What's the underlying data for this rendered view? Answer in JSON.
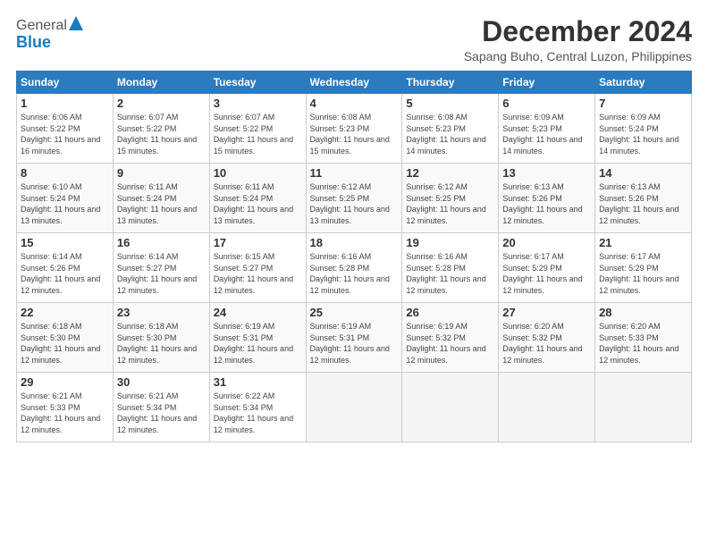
{
  "header": {
    "logo_general": "General",
    "logo_blue": "Blue",
    "title": "December 2024",
    "subtitle": "Sapang Buho, Central Luzon, Philippines"
  },
  "calendar": {
    "days_of_week": [
      "Sunday",
      "Monday",
      "Tuesday",
      "Wednesday",
      "Thursday",
      "Friday",
      "Saturday"
    ],
    "weeks": [
      [
        {
          "day": "1",
          "sunrise": "6:06 AM",
          "sunset": "5:22 PM",
          "daylight": "11 hours and 16 minutes."
        },
        {
          "day": "2",
          "sunrise": "6:07 AM",
          "sunset": "5:22 PM",
          "daylight": "11 hours and 15 minutes."
        },
        {
          "day": "3",
          "sunrise": "6:07 AM",
          "sunset": "5:22 PM",
          "daylight": "11 hours and 15 minutes."
        },
        {
          "day": "4",
          "sunrise": "6:08 AM",
          "sunset": "5:23 PM",
          "daylight": "11 hours and 15 minutes."
        },
        {
          "day": "5",
          "sunrise": "6:08 AM",
          "sunset": "5:23 PM",
          "daylight": "11 hours and 14 minutes."
        },
        {
          "day": "6",
          "sunrise": "6:09 AM",
          "sunset": "5:23 PM",
          "daylight": "11 hours and 14 minutes."
        },
        {
          "day": "7",
          "sunrise": "6:09 AM",
          "sunset": "5:24 PM",
          "daylight": "11 hours and 14 minutes."
        }
      ],
      [
        {
          "day": "8",
          "sunrise": "6:10 AM",
          "sunset": "5:24 PM",
          "daylight": "11 hours and 13 minutes."
        },
        {
          "day": "9",
          "sunrise": "6:11 AM",
          "sunset": "5:24 PM",
          "daylight": "11 hours and 13 minutes."
        },
        {
          "day": "10",
          "sunrise": "6:11 AM",
          "sunset": "5:24 PM",
          "daylight": "11 hours and 13 minutes."
        },
        {
          "day": "11",
          "sunrise": "6:12 AM",
          "sunset": "5:25 PM",
          "daylight": "11 hours and 13 minutes."
        },
        {
          "day": "12",
          "sunrise": "6:12 AM",
          "sunset": "5:25 PM",
          "daylight": "11 hours and 12 minutes."
        },
        {
          "day": "13",
          "sunrise": "6:13 AM",
          "sunset": "5:26 PM",
          "daylight": "11 hours and 12 minutes."
        },
        {
          "day": "14",
          "sunrise": "6:13 AM",
          "sunset": "5:26 PM",
          "daylight": "11 hours and 12 minutes."
        }
      ],
      [
        {
          "day": "15",
          "sunrise": "6:14 AM",
          "sunset": "5:26 PM",
          "daylight": "11 hours and 12 minutes."
        },
        {
          "day": "16",
          "sunrise": "6:14 AM",
          "sunset": "5:27 PM",
          "daylight": "11 hours and 12 minutes."
        },
        {
          "day": "17",
          "sunrise": "6:15 AM",
          "sunset": "5:27 PM",
          "daylight": "11 hours and 12 minutes."
        },
        {
          "day": "18",
          "sunrise": "6:16 AM",
          "sunset": "5:28 PM",
          "daylight": "11 hours and 12 minutes."
        },
        {
          "day": "19",
          "sunrise": "6:16 AM",
          "sunset": "5:28 PM",
          "daylight": "11 hours and 12 minutes."
        },
        {
          "day": "20",
          "sunrise": "6:17 AM",
          "sunset": "5:29 PM",
          "daylight": "11 hours and 12 minutes."
        },
        {
          "day": "21",
          "sunrise": "6:17 AM",
          "sunset": "5:29 PM",
          "daylight": "11 hours and 12 minutes."
        }
      ],
      [
        {
          "day": "22",
          "sunrise": "6:18 AM",
          "sunset": "5:30 PM",
          "daylight": "11 hours and 12 minutes."
        },
        {
          "day": "23",
          "sunrise": "6:18 AM",
          "sunset": "5:30 PM",
          "daylight": "11 hours and 12 minutes."
        },
        {
          "day": "24",
          "sunrise": "6:19 AM",
          "sunset": "5:31 PM",
          "daylight": "11 hours and 12 minutes."
        },
        {
          "day": "25",
          "sunrise": "6:19 AM",
          "sunset": "5:31 PM",
          "daylight": "11 hours and 12 minutes."
        },
        {
          "day": "26",
          "sunrise": "6:19 AM",
          "sunset": "5:32 PM",
          "daylight": "11 hours and 12 minutes."
        },
        {
          "day": "27",
          "sunrise": "6:20 AM",
          "sunset": "5:32 PM",
          "daylight": "11 hours and 12 minutes."
        },
        {
          "day": "28",
          "sunrise": "6:20 AM",
          "sunset": "5:33 PM",
          "daylight": "11 hours and 12 minutes."
        }
      ],
      [
        {
          "day": "29",
          "sunrise": "6:21 AM",
          "sunset": "5:33 PM",
          "daylight": "11 hours and 12 minutes."
        },
        {
          "day": "30",
          "sunrise": "6:21 AM",
          "sunset": "5:34 PM",
          "daylight": "11 hours and 12 minutes."
        },
        {
          "day": "31",
          "sunrise": "6:22 AM",
          "sunset": "5:34 PM",
          "daylight": "11 hours and 12 minutes."
        },
        null,
        null,
        null,
        null
      ]
    ]
  }
}
